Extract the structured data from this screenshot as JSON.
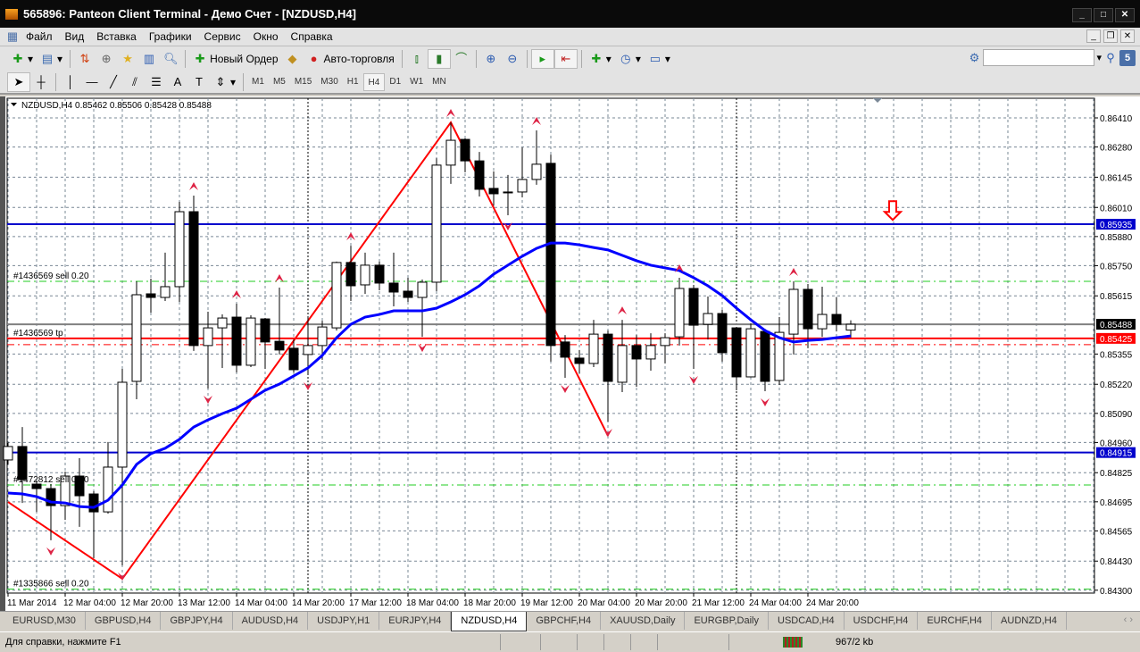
{
  "window": {
    "title": "565896: Panteon Client Terminal - Демо Счет - [NZDUSD,H4]"
  },
  "menu": [
    "Файл",
    "Вид",
    "Вставка",
    "Графики",
    "Сервис",
    "Окно",
    "Справка"
  ],
  "toolbar": {
    "new_order": "Новый Ордер",
    "autotrade": "Авто-торговля",
    "search_placeholder": "",
    "notifications_count": "5"
  },
  "timeframes": [
    "M1",
    "M5",
    "M15",
    "M30",
    "H1",
    "H4",
    "D1",
    "W1",
    "MN"
  ],
  "active_timeframe": "H4",
  "chart": {
    "header": "NZDUSD,H4  0.85462 0.85506 0.85428 0.85488",
    "price_ticks": [
      0.8641,
      0.8628,
      0.86145,
      0.8601,
      0.8588,
      0.8575,
      0.85615,
      0.85355,
      0.8522,
      0.8509,
      0.8496,
      0.84825,
      0.84695,
      0.84565,
      0.8443,
      0.843
    ],
    "price_tick_labels": [
      "0.86410",
      "0.86280",
      "0.86145",
      "0.86010",
      "0.85880",
      "0.85750",
      "0.85615",
      "0.85355",
      "0.85220",
      "0.85090",
      "0.84960",
      "0.84825",
      "0.84695",
      "0.84565",
      "0.84430",
      "0.84300"
    ],
    "time_labels": [
      "11 Mar 2014",
      "12 Mar 04:00",
      "12 Mar 20:00",
      "13 Mar 12:00",
      "14 Mar 04:00",
      "14 Mar 20:00",
      "17 Mar 12:00",
      "18 Mar 04:00",
      "18 Mar 20:00",
      "19 Mar 12:00",
      "20 Mar 04:00",
      "20 Mar 20:00",
      "21 Mar 12:00",
      "24 Mar 04:00",
      "24 Mar 20:00"
    ],
    "price_labels": [
      {
        "text": "0.85935",
        "price": 0.85935,
        "color": "#0000cc"
      },
      {
        "text": "0.85488",
        "price": 0.85488,
        "color": "#000000"
      },
      {
        "text": "0.85425",
        "price": 0.85425,
        "color": "#ff0000"
      },
      {
        "text": "0.84915",
        "price": 0.84915,
        "color": "#0000cc"
      }
    ],
    "hlines": [
      {
        "price": 0.85935,
        "color": "#0000cc",
        "style": "solid"
      },
      {
        "price": 0.84915,
        "color": "#0000cc",
        "style": "solid"
      },
      {
        "price": 0.85488,
        "color": "#808080",
        "style": "solid"
      },
      {
        "price": 0.85425,
        "color": "#ff0000",
        "style": "solid"
      },
      {
        "price": 0.85397,
        "color": "#ff0000",
        "style": "dashdot"
      },
      {
        "price": 0.8568,
        "color": "#22cc22",
        "style": "dashdot"
      },
      {
        "price": 0.8477,
        "color": "#22cc22",
        "style": "dashdot"
      },
      {
        "price": 0.84305,
        "color": "#22cc22",
        "style": "dashdot"
      }
    ],
    "order_labels": [
      {
        "text": "#1436569 sell 0.20",
        "price": 0.8568
      },
      {
        "text": "#1436569 tp",
        "price": 0.85425
      },
      {
        "text": "#1472812 sell 0.20",
        "price": 0.8477
      },
      {
        "text": "#1335866 sell 0.20",
        "price": 0.84305
      }
    ],
    "period_separators_bars": [
      22,
      52
    ],
    "candles": [
      [
        0.84882,
        0.84962,
        0.84862,
        0.84942
      ],
      [
        0.84942,
        0.85029,
        0.8469,
        0.84794
      ],
      [
        0.84774,
        0.8479,
        0.8465,
        0.84754
      ],
      [
        0.84754,
        0.84774,
        0.84523,
        0.84678
      ],
      [
        0.84678,
        0.8483,
        0.84614,
        0.8481
      ],
      [
        0.8481,
        0.8489,
        0.84583,
        0.84722
      ],
      [
        0.8473,
        0.84742,
        0.84443,
        0.8465
      ],
      [
        0.8465,
        0.84962,
        0.84642,
        0.8485
      ],
      [
        0.8485,
        0.85289,
        0.84411,
        0.85229
      ],
      [
        0.85233,
        0.8568,
        0.85153,
        0.8562
      ],
      [
        0.85624,
        0.85692,
        0.8554,
        0.85608
      ],
      [
        0.85608,
        0.85808,
        0.85592,
        0.85656
      ],
      [
        0.85656,
        0.86035,
        0.85588,
        0.85991
      ],
      [
        0.85991,
        0.86063,
        0.85369,
        0.85393
      ],
      [
        0.85393,
        0.85544,
        0.85201,
        0.85472
      ],
      [
        0.85472,
        0.85532,
        0.85293,
        0.85516
      ],
      [
        0.8552,
        0.8558,
        0.85273,
        0.85305
      ],
      [
        0.85305,
        0.85528,
        0.85297,
        0.85516
      ],
      [
        0.85512,
        0.85516,
        0.85289,
        0.85409
      ],
      [
        0.85412,
        0.85652,
        0.85353,
        0.85373
      ],
      [
        0.85381,
        0.8542,
        0.85273,
        0.85285
      ],
      [
        0.85353,
        0.85516,
        0.85261,
        0.85393
      ],
      [
        0.85393,
        0.85504,
        0.85329,
        0.85476
      ],
      [
        0.85472,
        0.85768,
        0.8546,
        0.85764
      ],
      [
        0.85764,
        0.85839,
        0.85592,
        0.8566
      ],
      [
        0.85664,
        0.85808,
        0.85624,
        0.85752
      ],
      [
        0.85752,
        0.85768,
        0.8564,
        0.85672
      ],
      [
        0.85672,
        0.85808,
        0.85568,
        0.85632
      ],
      [
        0.85636,
        0.85696,
        0.85588,
        0.85608
      ],
      [
        0.85608,
        0.85688,
        0.85432,
        0.85676
      ],
      [
        0.85676,
        0.8623,
        0.85636,
        0.86199
      ],
      [
        0.86199,
        0.8639,
        0.86115,
        0.8631
      ],
      [
        0.86314,
        0.86318,
        0.86167,
        0.86218
      ],
      [
        0.86218,
        0.86258,
        0.86059,
        0.86091
      ],
      [
        0.86095,
        0.86171,
        0.86019,
        0.86071
      ],
      [
        0.86075,
        0.86155,
        0.85975,
        0.86079
      ],
      [
        0.86079,
        0.86278,
        0.86055,
        0.86135
      ],
      [
        0.86135,
        0.86354,
        0.86111,
        0.86203
      ],
      [
        0.86207,
        0.86246,
        0.85321,
        0.85393
      ],
      [
        0.85409,
        0.8544,
        0.85249,
        0.85341
      ],
      [
        0.85337,
        0.85373,
        0.85269,
        0.85313
      ],
      [
        0.85313,
        0.85508,
        0.85297,
        0.85444
      ],
      [
        0.85444,
        0.8546,
        0.85053,
        0.85233
      ],
      [
        0.85229,
        0.85508,
        0.85185,
        0.85393
      ],
      [
        0.85393,
        0.8544,
        0.85209,
        0.85333
      ],
      [
        0.85333,
        0.85448,
        0.85281,
        0.85393
      ],
      [
        0.85393,
        0.85448,
        0.85313,
        0.85428
      ],
      [
        0.85432,
        0.85696,
        0.85393,
        0.85648
      ],
      [
        0.85648,
        0.85664,
        0.85289,
        0.85484
      ],
      [
        0.85488,
        0.85612,
        0.8542,
        0.85536
      ],
      [
        0.85536,
        0.85552,
        0.85321,
        0.85361
      ],
      [
        0.85472,
        0.85472,
        0.85193,
        0.85253
      ],
      [
        0.85253,
        0.85492,
        0.85253,
        0.85468
      ],
      [
        0.85456,
        0.85468,
        0.85189,
        0.85233
      ],
      [
        0.85237,
        0.8552,
        0.85217,
        0.85452
      ],
      [
        0.85444,
        0.8568,
        0.85353,
        0.85644
      ],
      [
        0.85644,
        0.85668,
        0.85381,
        0.85468
      ],
      [
        0.85468,
        0.85656,
        0.85432,
        0.85532
      ],
      [
        0.85532,
        0.85608,
        0.85456,
        0.85488
      ],
      [
        0.85462,
        0.85506,
        0.85428,
        0.85488
      ]
    ],
    "moving_average": [
      0.84734,
      0.8473,
      0.84718,
      0.84694,
      0.8469,
      0.84674,
      0.8467,
      0.84702,
      0.8477,
      0.84862,
      0.8491,
      0.84934,
      0.84974,
      0.85029,
      0.85061,
      0.85089,
      0.85113,
      0.85153,
      0.85193,
      0.85221,
      0.85257,
      0.85293,
      0.85349,
      0.85428,
      0.85488,
      0.8552,
      0.85532,
      0.85548,
      0.85548,
      0.85548,
      0.8556,
      0.85588,
      0.8562,
      0.8566,
      0.85712,
      0.85752,
      0.85792,
      0.85827,
      0.85851,
      0.85851,
      0.85843,
      0.85831,
      0.8582,
      0.85796,
      0.85772,
      0.85752,
      0.8574,
      0.85728,
      0.85696,
      0.8566,
      0.85616,
      0.8556,
      0.85508,
      0.8546,
      0.85428,
      0.85409,
      0.85416,
      0.8542,
      0.85428,
      0.85436
    ],
    "zigzag": [
      {
        "bar": 1,
        "price": 0.84694
      },
      {
        "bar": 9,
        "price": 0.84351
      },
      {
        "bar": 32,
        "price": 0.8639
      },
      {
        "bar": 43,
        "price": 0.8499
      }
    ],
    "fractals_up": [
      14,
      17,
      20,
      25,
      32,
      38,
      44,
      48,
      56
    ],
    "fractals_down": [
      4,
      9,
      15,
      22,
      30,
      36,
      40,
      43,
      49,
      54
    ],
    "sell_arrow_price": 0.8599,
    "colors": {
      "grid": "#7a8896",
      "ma": "#0000ff",
      "zigzag": "#ff0000",
      "fractal": "#dd2244"
    }
  },
  "tabs": [
    "EURUSD,M30",
    "GBPUSD,H4",
    "GBPJPY,H4",
    "AUDUSD,H4",
    "USDJPY,H1",
    "EURJPY,H4",
    "NZDUSD,H4",
    "GBPCHF,H4",
    "XAUUSD,Daily",
    "EURGBP,Daily",
    "USDCAD,H4",
    "USDCHF,H4",
    "EURCHF,H4",
    "AUDNZD,H4"
  ],
  "active_tab": "NZDUSD,H4",
  "status": {
    "help": "Для справки, нажмите F1",
    "traffic": "967/2 kb"
  }
}
